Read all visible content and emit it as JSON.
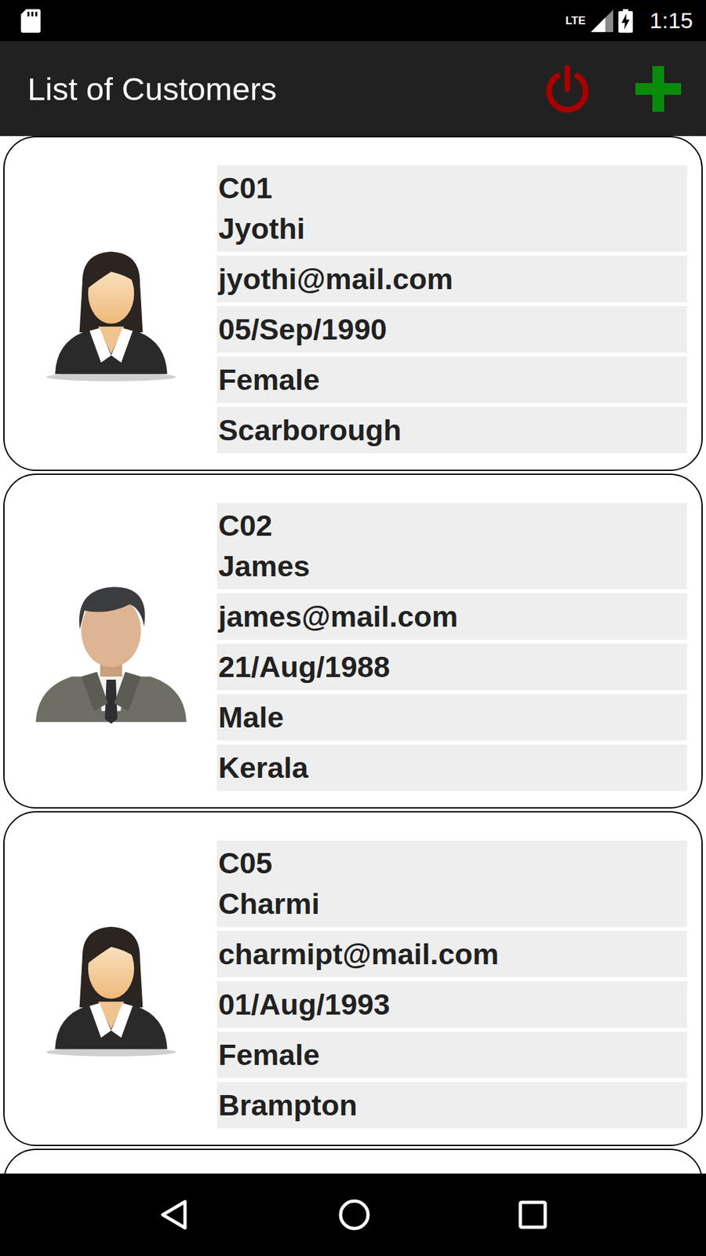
{
  "status_bar": {
    "network": "LTE",
    "time": "1:15"
  },
  "app_bar": {
    "title": "List of Customers"
  },
  "customers": [
    {
      "id": "C01",
      "name": "Jyothi",
      "email": "jyothi@mail.com",
      "dob": "05/Sep/1990",
      "gender": "Female",
      "city": "Scarborough",
      "kind": "female"
    },
    {
      "id": "C02",
      "name": "James",
      "email": "james@mail.com",
      "dob": "21/Aug/1988",
      "gender": "Male",
      "city": "Kerala",
      "kind": "male"
    },
    {
      "id": "C05",
      "name": "Charmi",
      "email": "charmipt@mail.com",
      "dob": "01/Aug/1993",
      "gender": "Female",
      "city": "Brampton",
      "kind": "female"
    }
  ]
}
